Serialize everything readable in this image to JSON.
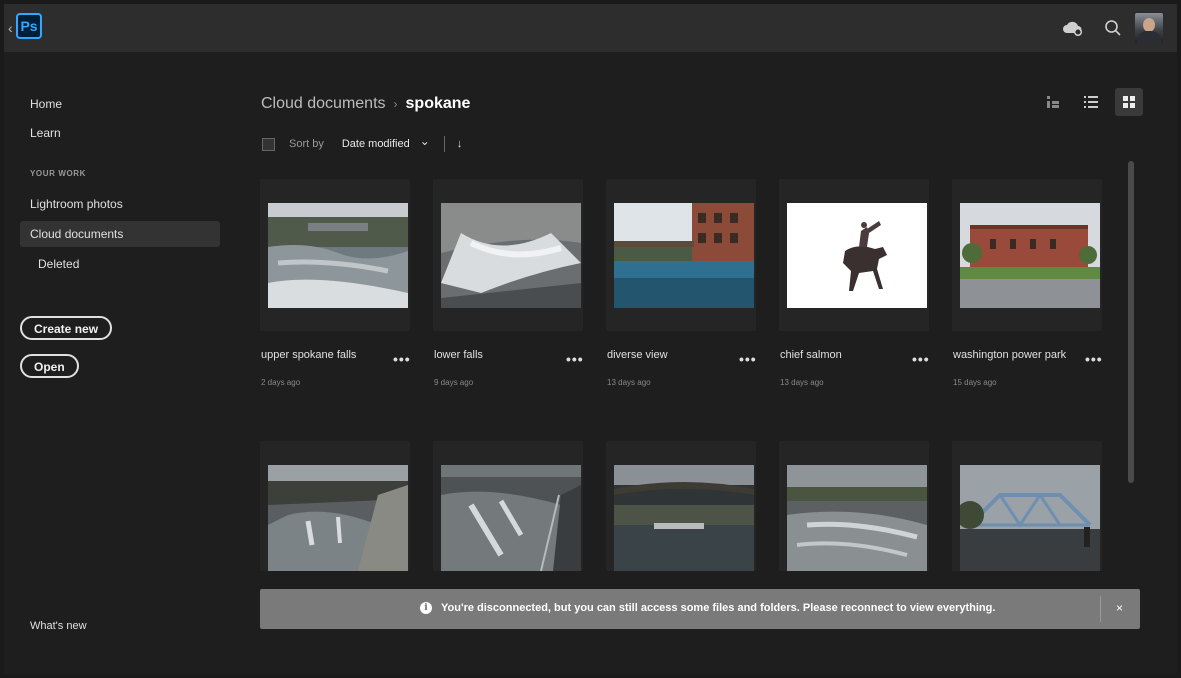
{
  "app": {
    "logo_text": "Ps"
  },
  "topbar": {
    "icons": [
      "cloud-sync-icon",
      "search-icon"
    ]
  },
  "sidebar": {
    "home": "Home",
    "learn": "Learn",
    "section_label": "YOUR WORK",
    "lightroom": "Lightroom photos",
    "cloud_documents": "Cloud documents",
    "deleted": "Deleted",
    "create_new": "Create new",
    "open": "Open",
    "whats_new": "What's new"
  },
  "breadcrumb": {
    "parent": "Cloud documents",
    "separator": "›",
    "current": "spokane"
  },
  "sort": {
    "label": "Sort by",
    "value": "Date modified",
    "chevron": "⌄",
    "direction": "↓"
  },
  "files": [
    {
      "name": "upper spokane falls",
      "date": "2 days ago"
    },
    {
      "name": "lower falls",
      "date": "9 days ago"
    },
    {
      "name": "diverse view",
      "date": "13 days ago"
    },
    {
      "name": "chief salmon",
      "date": "13 days ago"
    },
    {
      "name": "washington power park",
      "date": "15 days ago"
    }
  ],
  "more_label": "•••",
  "toast": {
    "message": "You're disconnected, but you can still access some files and folders. Please reconnect to view everything.",
    "info": "i",
    "close": "×"
  }
}
